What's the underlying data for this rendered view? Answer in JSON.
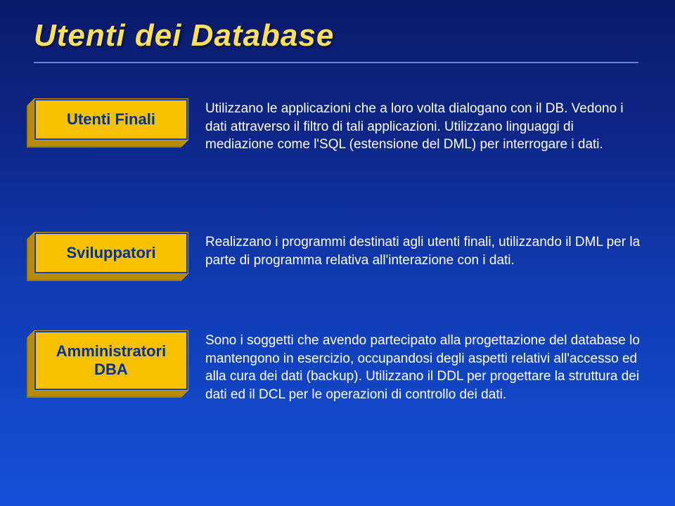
{
  "title": "Utenti dei Database",
  "rows": [
    {
      "label": "Utenti Finali",
      "desc": "Utilizzano le applicazioni che a loro volta dialogano con il DB. Vedono i dati attraverso il filtro di tali applicazioni. Utilizzano linguaggi di mediazione come l'SQL (estensione del DML) per interrogare i dati."
    },
    {
      "label": "Sviluppatori",
      "desc": "Realizzano i programmi destinati agli utenti finali, utilizzando il DML per la parte di programma relativa all'interazione con i dati."
    },
    {
      "label": "Amministratori DBA",
      "desc": "Sono i soggetti che avendo partecipato alla progettazione del database lo mantengono in esercizio, occupandosi degli aspetti relativi all'accesso ed alla cura dei dati (backup). Utilizzano il DDL per progettare la struttura dei dati ed il DCL per le operazioni di controllo dei dati."
    }
  ]
}
